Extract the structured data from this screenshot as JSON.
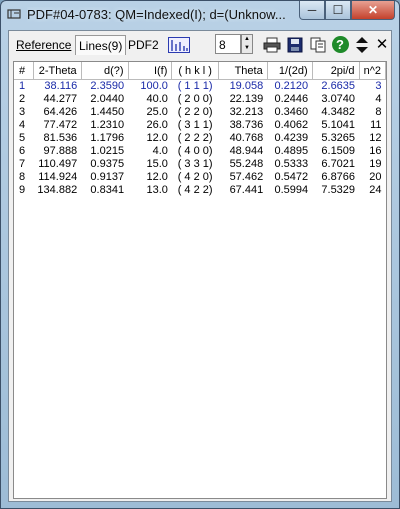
{
  "window": {
    "title": "PDF#04-0783: QM=Indexed(I); d=(Unknow...",
    "min_glyph": "─",
    "max_glyph": "☐",
    "close_glyph": "✕"
  },
  "tabs": [
    {
      "label": "Reference"
    },
    {
      "label": "Lines(9)"
    },
    {
      "label": "PDF2"
    }
  ],
  "toolbar": {
    "lines_value": "8",
    "icons": [
      "line-plot-icon",
      "printer-icon",
      "save-icon",
      "copy-icon",
      "help-icon",
      "sort-icon",
      "close-icon"
    ],
    "close_glyph": "✕",
    "help_glyph": "?",
    "sort_glyph": "⇕"
  },
  "table": {
    "headers": [
      "#",
      "2-Theta",
      "d(?)",
      "I(f)",
      "( h k l )",
      "Theta",
      "1/(2d)",
      "2pi/d",
      "n^2"
    ],
    "rows": [
      [
        "1",
        "38.116",
        "2.3590",
        "100.0",
        "( 1 1 1)",
        "19.058",
        "0.2120",
        "2.6635",
        "3"
      ],
      [
        "2",
        "44.277",
        "2.0440",
        "40.0",
        "( 2 0 0)",
        "22.139",
        "0.2446",
        "3.0740",
        "4"
      ],
      [
        "3",
        "64.426",
        "1.4450",
        "25.0",
        "( 2 2 0)",
        "32.213",
        "0.3460",
        "4.3482",
        "8"
      ],
      [
        "4",
        "77.472",
        "1.2310",
        "26.0",
        "( 3 1 1)",
        "38.736",
        "0.4062",
        "5.1041",
        "11"
      ],
      [
        "5",
        "81.536",
        "1.1796",
        "12.0",
        "( 2 2 2)",
        "40.768",
        "0.4239",
        "5.3265",
        "12"
      ],
      [
        "6",
        "97.888",
        "1.0215",
        "4.0",
        "( 4 0 0)",
        "48.944",
        "0.4895",
        "6.1509",
        "16"
      ],
      [
        "7",
        "110.497",
        "0.9375",
        "15.0",
        "( 3 3 1)",
        "55.248",
        "0.5333",
        "6.7021",
        "19"
      ],
      [
        "8",
        "114.924",
        "0.9137",
        "12.0",
        "( 4 2 0)",
        "57.462",
        "0.5472",
        "6.8766",
        "20"
      ],
      [
        "9",
        "134.882",
        "0.8341",
        "13.0",
        "( 4 2 2)",
        "67.441",
        "0.5994",
        "7.5329",
        "24"
      ]
    ],
    "selected_row": 0
  },
  "colors": {
    "selected_text": "#1a2aa8",
    "titlebar": "#b9d1e6"
  }
}
